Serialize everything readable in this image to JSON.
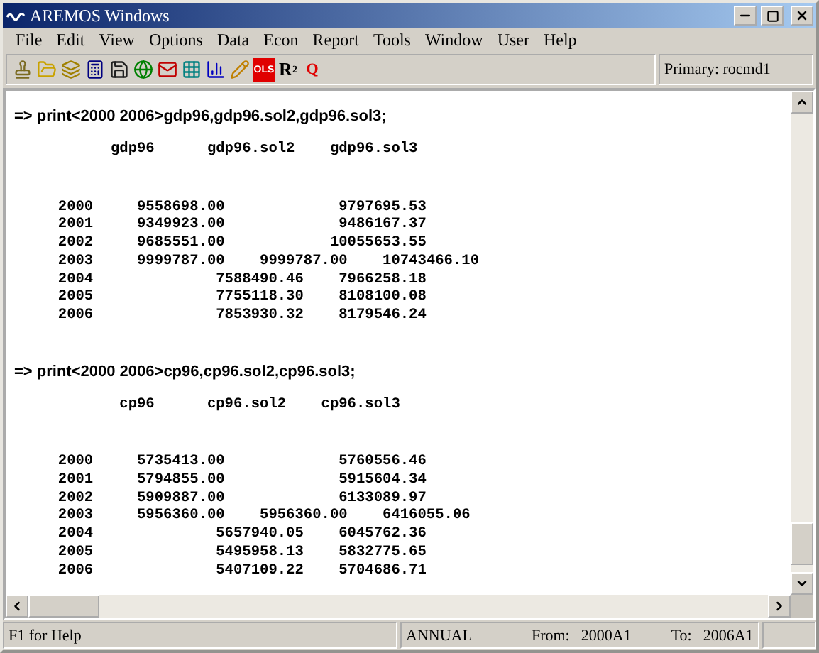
{
  "window": {
    "title": "AREMOS Windows"
  },
  "menu": [
    "File",
    "Edit",
    "View",
    "Options",
    "Data",
    "Econ",
    "Report",
    "Tools",
    "Window",
    "User",
    "Help"
  ],
  "toolbar": {
    "text_buttons": [
      {
        "label": "OLS",
        "kind": "boxed"
      },
      {
        "label": "R",
        "sup": "2",
        "kind": "plain"
      },
      {
        "label": "Q",
        "kind": "red"
      }
    ],
    "primary": "Primary: rocmd1"
  },
  "output": [
    {
      "command": "=> print<2000 2006>gdp96,gdp96.sol2,gdp96.sol3;",
      "header": "           gdp96      gdp96.sol2    gdp96.sol3",
      "rows": [
        "     2000     9558698.00             9797695.53",
        "     2001     9349923.00             9486167.37",
        "     2002     9685551.00            10055653.55",
        "     2003     9999787.00    9999787.00    10743466.10",
        "     2004              7588490.46    7966258.18",
        "     2005              7755118.30    8108100.08",
        "     2006              7853930.32    8179546.24"
      ]
    },
    {
      "command": "=> print<2000 2006>cp96,cp96.sol2,cp96.sol3;",
      "header": "            cp96      cp96.sol2    cp96.sol3",
      "rows": [
        "     2000     5735413.00             5760556.46",
        "     2001     5794855.00             5915604.34",
        "     2002     5909887.00             6133089.97",
        "     2003     5956360.00    5956360.00    6416055.06",
        "     2004              5657940.05    6045762.36",
        "     2005              5495958.13    5832775.65",
        "     2006              5407109.22    5704686.71"
      ]
    }
  ],
  "status_bar": {
    "help": "F1 for Help",
    "frequency": "ANNUAL",
    "from_label": "From:",
    "from": "2000A1",
    "to_label": "To:",
    "to": "2006A1"
  }
}
